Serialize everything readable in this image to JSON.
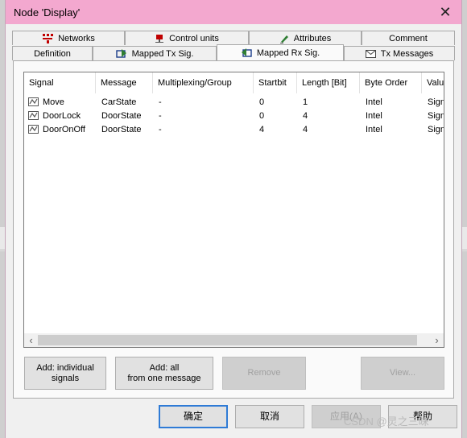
{
  "window": {
    "title": "Node 'Display'"
  },
  "tabs_top": [
    {
      "label": "Networks",
      "icon": "networks-icon"
    },
    {
      "label": "Control units",
      "icon": "control-units-icon"
    },
    {
      "label": "Attributes",
      "icon": "attributes-icon"
    },
    {
      "label": "Comment"
    }
  ],
  "tabs_bottom": [
    {
      "label": "Definition"
    },
    {
      "label": "Mapped Tx Sig.",
      "icon": "mapped-tx-icon"
    },
    {
      "label": "Mapped Rx Sig.",
      "icon": "mapped-rx-icon",
      "active": true
    },
    {
      "label": "Tx Messages",
      "icon": "envelope-icon"
    }
  ],
  "table": {
    "columns": [
      "Signal",
      "Message",
      "Multiplexing/Group",
      "Startbit",
      "Length [Bit]",
      "Byte Order",
      "Value"
    ],
    "rows": [
      [
        "Move",
        "CarState",
        "-",
        "0",
        "1",
        "Intel",
        "Sign"
      ],
      [
        "DoorLock",
        "DoorState",
        "-",
        "0",
        "4",
        "Intel",
        "Sign"
      ],
      [
        "DoorOnOff",
        "DoorState",
        "-",
        "4",
        "4",
        "Intel",
        "Sign"
      ]
    ]
  },
  "actions": {
    "add_individual": "Add: individual\nsignals",
    "add_all": "Add: all\nfrom one message",
    "remove": "Remove",
    "view": "View..."
  },
  "dialog_buttons": {
    "ok": "确定",
    "cancel": "取消",
    "apply": "应用(A)",
    "help": "帮助"
  },
  "watermark": "CSDN @灵之三昧",
  "colors": {
    "titlebar": "#f3a8cf",
    "default_button_border": "#2f7bd6"
  }
}
